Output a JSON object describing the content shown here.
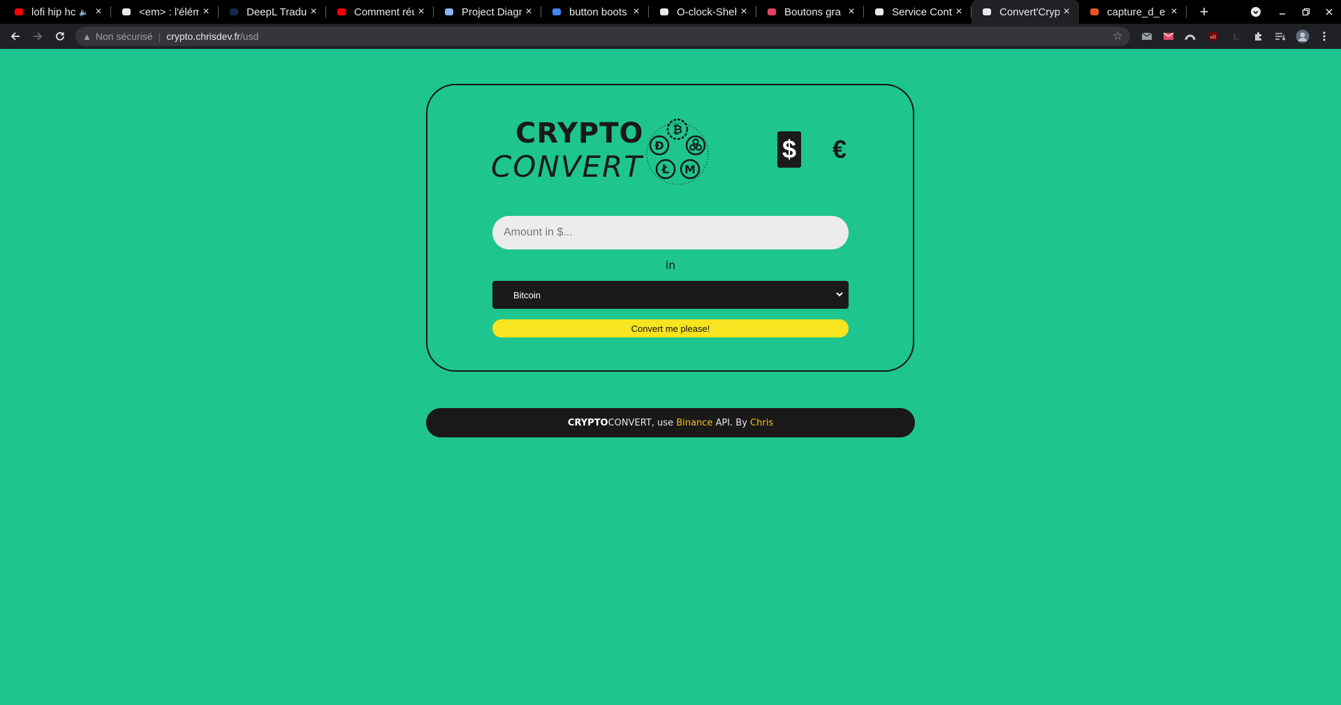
{
  "browser": {
    "tabs": [
      {
        "title": "lofi hip hc",
        "icon": "youtube-icon",
        "icon_color": "#ff0000",
        "muted": true
      },
      {
        "title": "<em> : l'élém",
        "icon": "mdn-icon",
        "icon_color": "#e8eaed"
      },
      {
        "title": "DeepL Tradu",
        "icon": "deepl-icon",
        "icon_color": "#0f2b46"
      },
      {
        "title": "Comment réu",
        "icon": "youtube-icon",
        "icon_color": "#ff0000"
      },
      {
        "title": "Project Diagr",
        "icon": "flag-icon",
        "icon_color": "#8ab4f8"
      },
      {
        "title": "button boots",
        "icon": "google-icon",
        "icon_color": "#4285f4"
      },
      {
        "title": "O-clock-Sheh",
        "icon": "github-icon",
        "icon_color": "#e8eaed"
      },
      {
        "title": "Boutons gra",
        "icon": "hash-icon",
        "icon_color": "#e4405f"
      },
      {
        "title": "Service Conta",
        "icon": "symfony-icon",
        "icon_color": "#e8eaed"
      },
      {
        "title": "Convert'Cryp",
        "icon": "globe-icon",
        "icon_color": "#e8eaed",
        "active": true
      },
      {
        "title": "capture_d_e",
        "icon": "ubuntu-icon",
        "icon_color": "#e95420"
      }
    ],
    "url": {
      "security_label": "Non sécurisé",
      "host": "crypto.chrisdev.fr",
      "path": "/usd"
    }
  },
  "page": {
    "logo": {
      "line1": "CRYPTO",
      "line2": "CONVERT"
    },
    "currencies": {
      "usd": "$",
      "eur": "€",
      "selected": "usd"
    },
    "amount": {
      "placeholder": "Amount in $...",
      "value": ""
    },
    "in_label": "in",
    "crypto_select": {
      "selected": "Bitcoin"
    },
    "convert_button": "Convert me please!",
    "footer": {
      "brand_bold": "CRYPTO",
      "brand_rest": "CONVERT",
      "text1": ", use ",
      "api_link": "Binance",
      "text2": " API. By ",
      "author_link": "Chris"
    }
  },
  "colors": {
    "background": "#1fc58f",
    "dark": "#1a1a1a",
    "button": "#f8e421",
    "link": "#f5c518"
  }
}
